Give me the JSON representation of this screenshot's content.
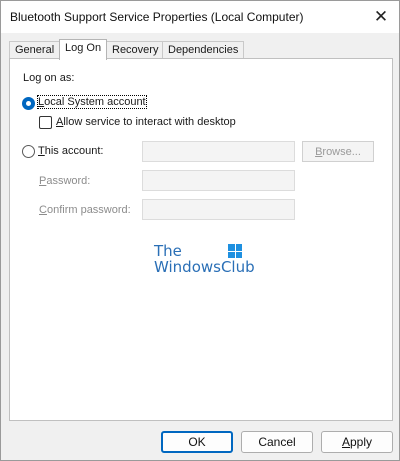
{
  "window": {
    "title": "Bluetooth Support Service Properties (Local Computer)",
    "close_glyph": "✕"
  },
  "tabs": [
    {
      "label": "General"
    },
    {
      "label": "Log On"
    },
    {
      "label": "Recovery"
    },
    {
      "label": "Dependencies"
    }
  ],
  "active_tab": "Log On",
  "logon": {
    "group_label": "Log on as:",
    "local_system": {
      "label_prefix": "",
      "label_access": "L",
      "label_rest": "ocal System account",
      "checked": true
    },
    "interact": {
      "label_access": "A",
      "label_rest": "llow service to interact with desktop",
      "checked": false
    },
    "this_account": {
      "label_access": "T",
      "label_rest": "his account:",
      "value": "",
      "checked": false
    },
    "browse_button": {
      "label_access": "B",
      "label_rest": "rowse..."
    },
    "password": {
      "label_access": "P",
      "label_rest": "assword:",
      "value": ""
    },
    "confirm_password": {
      "label_access": "C",
      "label_rest": "onfirm password:",
      "value": ""
    }
  },
  "watermark": {
    "line1": "The",
    "line2": "WindowsClub"
  },
  "footer": {
    "ok": "OK",
    "cancel": "Cancel",
    "apply_access": "A",
    "apply_rest": "pply"
  },
  "colors": {
    "accent": "#0067c0",
    "watermark": "#2a6fb6"
  }
}
